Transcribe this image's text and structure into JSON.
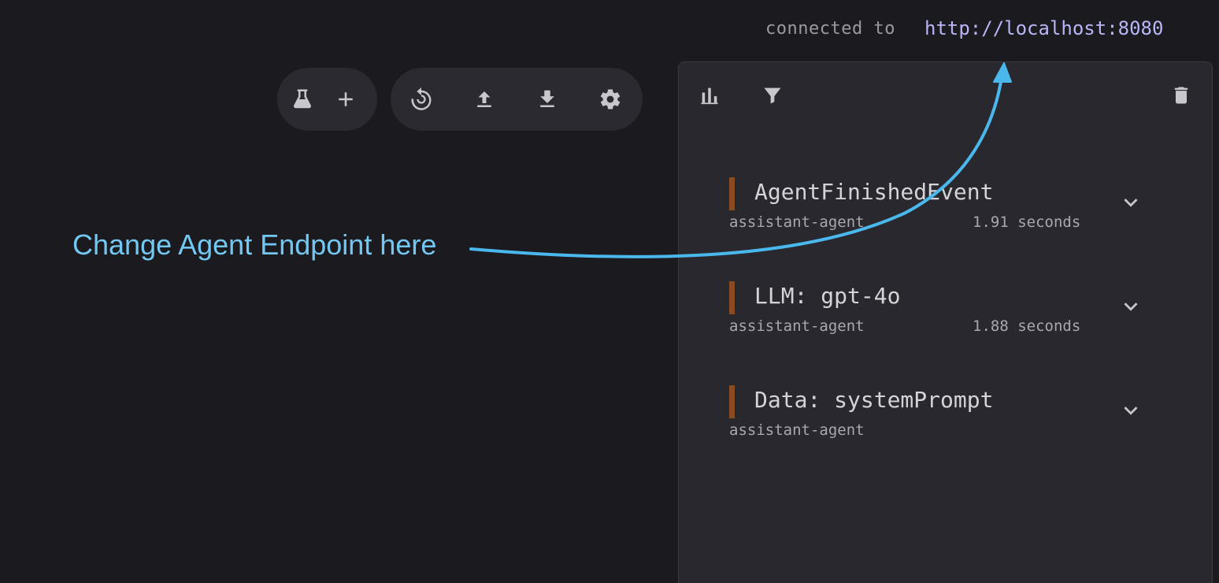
{
  "header": {
    "connected_label": "connected to",
    "endpoint_url": "http://localhost:8080"
  },
  "toolbar_left": {
    "icons": [
      "flask-icon",
      "plus-icon"
    ]
  },
  "toolbar_right": {
    "icons": [
      "restart-icon",
      "upload-icon",
      "download-icon",
      "gear-icon"
    ]
  },
  "events_panel": {
    "icons": [
      "bar-chart-icon",
      "filter-icon",
      "trash-icon"
    ],
    "events": [
      {
        "title": "AgentFinishedEvent",
        "agent": "assistant-agent",
        "duration": "1.91 seconds",
        "color": "#8a4a22"
      },
      {
        "title": "LLM: gpt-4o",
        "agent": "assistant-agent",
        "duration": "1.88 seconds",
        "color": "#8a4a22"
      },
      {
        "title": "Data: systemPrompt",
        "agent": "assistant-agent",
        "duration": "",
        "color": "#8a4a22"
      }
    ]
  },
  "annotation": {
    "text": "Change Agent Endpoint here",
    "color": "#72c8f2"
  }
}
